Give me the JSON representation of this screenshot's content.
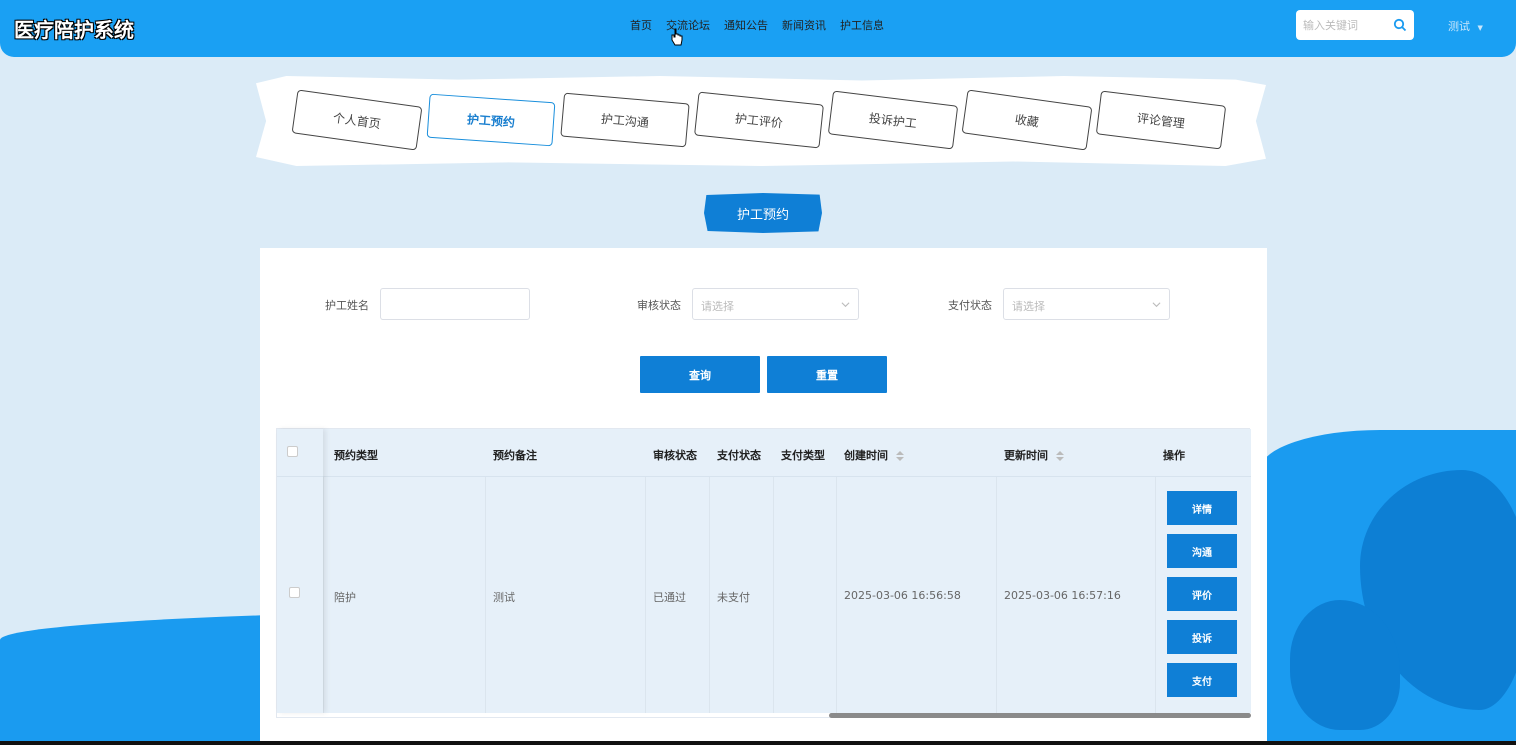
{
  "header": {
    "logo": "医疗陪护系统",
    "nav": [
      "首页",
      "交流论坛",
      "通知公告",
      "新闻资讯",
      "护工信息"
    ],
    "search_placeholder": "输入关键词",
    "user": "测试"
  },
  "tabs": [
    {
      "label": "个人首页",
      "active": false
    },
    {
      "label": "护工预约",
      "active": true
    },
    {
      "label": "护工沟通",
      "active": false
    },
    {
      "label": "护工评价",
      "active": false
    },
    {
      "label": "投诉护工",
      "active": false
    },
    {
      "label": "收藏",
      "active": false
    },
    {
      "label": "评论管理",
      "active": false
    }
  ],
  "page_title": "护工预约",
  "filters": {
    "name_label": "护工姓名",
    "name_value": "",
    "audit_label": "审核状态",
    "audit_placeholder": "请选择",
    "pay_label": "支付状态",
    "pay_placeholder": "请选择",
    "query_button": "查询",
    "reset_button": "重置"
  },
  "table": {
    "columns": [
      "预约类型",
      "预约备注",
      "审核状态",
      "支付状态",
      "支付类型",
      "创建时间",
      "更新时间",
      "操作"
    ],
    "rows": [
      {
        "type": "陪护",
        "remark": "测试",
        "audit": "已通过",
        "pay_status": "未支付",
        "pay_type": "",
        "created": "2025-03-06 16:56:58",
        "updated": "2025-03-06 16:57:16",
        "actions": [
          "详情",
          "沟通",
          "评价",
          "投诉",
          "支付"
        ]
      }
    ]
  },
  "colors": {
    "header": "#1aa0f3",
    "primary": "#0f7fd6",
    "background": "#dbebf7"
  }
}
